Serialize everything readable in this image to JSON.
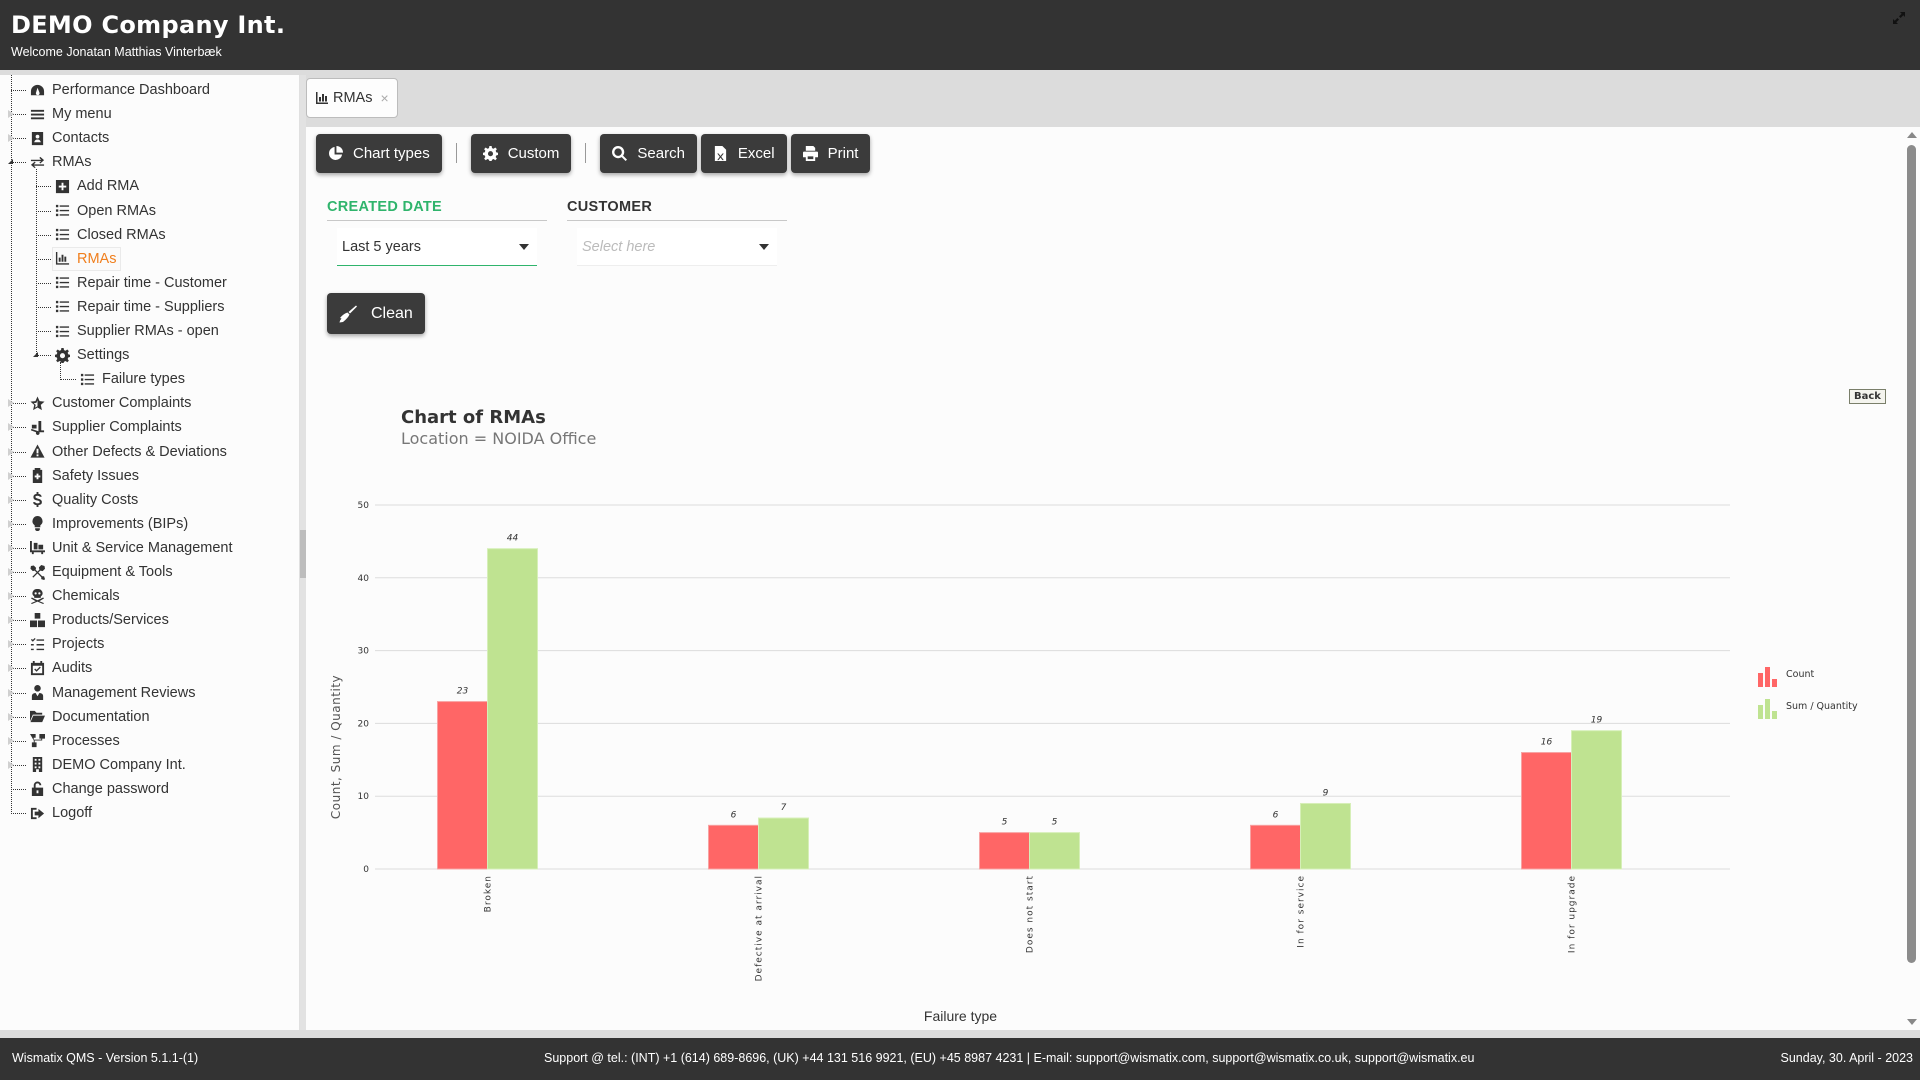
{
  "header": {
    "title": "DEMO Company Int.",
    "welcome": "Welcome Jonatan Matthias Vinterbæk",
    "expand_icon": "expand-arrows-icon"
  },
  "sidebar": {
    "items": [
      {
        "label": "Performance Dashboard",
        "icon": "dashboard-icon",
        "level": 0,
        "expander": "none"
      },
      {
        "label": "My menu",
        "icon": "bars-icon",
        "level": 0,
        "expander": "collapsed"
      },
      {
        "label": "Contacts",
        "icon": "contact-card-icon",
        "level": 0,
        "expander": "collapsed"
      },
      {
        "label": "RMAs",
        "icon": "exchange-icon",
        "level": 0,
        "expander": "expanded"
      },
      {
        "label": "Add RMA",
        "icon": "plus-square-icon",
        "level": 1,
        "expander": "none"
      },
      {
        "label": "Open RMAs",
        "icon": "list-icon",
        "level": 1,
        "expander": "none"
      },
      {
        "label": "Closed RMAs",
        "icon": "list-icon",
        "level": 1,
        "expander": "none"
      },
      {
        "label": "RMAs",
        "icon": "bar-chart-icon",
        "level": 1,
        "expander": "none",
        "active": true
      },
      {
        "label": "Repair time - Customer",
        "icon": "list-icon",
        "level": 1,
        "expander": "none"
      },
      {
        "label": "Repair time - Suppliers",
        "icon": "list-icon",
        "level": 1,
        "expander": "none"
      },
      {
        "label": "Supplier RMAs - open",
        "icon": "list-icon",
        "level": 1,
        "expander": "none"
      },
      {
        "label": "Settings",
        "icon": "gear-icon",
        "level": 1,
        "expander": "expanded"
      },
      {
        "label": "Failure types",
        "icon": "list-icon",
        "level": 2,
        "expander": "none"
      },
      {
        "label": "Customer Complaints",
        "icon": "star-outline-icon",
        "level": 0,
        "expander": "collapsed"
      },
      {
        "label": "Supplier Complaints",
        "icon": "dolly-icon",
        "level": 0,
        "expander": "collapsed"
      },
      {
        "label": "Other Defects & Deviations",
        "icon": "warning-icon",
        "level": 0,
        "expander": "collapsed"
      },
      {
        "label": "Safety Issues",
        "icon": "first-aid-icon",
        "level": 0,
        "expander": "collapsed"
      },
      {
        "label": "Quality Costs",
        "icon": "dollar-icon",
        "level": 0,
        "expander": "collapsed"
      },
      {
        "label": "Improvements (BIPs)",
        "icon": "lightbulb-icon",
        "level": 0,
        "expander": "collapsed"
      },
      {
        "label": "Unit & Service Management",
        "icon": "pallet-icon",
        "level": 0,
        "expander": "collapsed"
      },
      {
        "label": "Equipment & Tools",
        "icon": "tools-icon",
        "level": 0,
        "expander": "collapsed"
      },
      {
        "label": "Chemicals",
        "icon": "skull-crossbones-icon",
        "level": 0,
        "expander": "collapsed"
      },
      {
        "label": "Products/Services",
        "icon": "boxes-icon",
        "level": 0,
        "expander": "collapsed"
      },
      {
        "label": "Projects",
        "icon": "tasks-icon",
        "level": 0,
        "expander": "collapsed"
      },
      {
        "label": "Audits",
        "icon": "calendar-check-icon",
        "level": 0,
        "expander": "collapsed"
      },
      {
        "label": "Management Reviews",
        "icon": "user-tie-icon",
        "level": 0,
        "expander": "collapsed"
      },
      {
        "label": "Documentation",
        "icon": "folder-open-icon",
        "level": 0,
        "expander": "collapsed"
      },
      {
        "label": "Processes",
        "icon": "sitemap-icon",
        "level": 0,
        "expander": "collapsed"
      },
      {
        "label": "DEMO Company Int.",
        "icon": "building-icon",
        "level": 0,
        "expander": "collapsed"
      },
      {
        "label": "Change password",
        "icon": "unlock-icon",
        "level": 0,
        "expander": "none"
      },
      {
        "label": "Logoff",
        "icon": "sign-out-icon",
        "level": 0,
        "expander": "none"
      }
    ]
  },
  "tabs": [
    {
      "label": "RMAs",
      "icon": "bar-chart-icon",
      "close": "×"
    }
  ],
  "toolbar": {
    "chart_types": "Chart types",
    "custom": "Custom",
    "search": "Search",
    "excel": "Excel",
    "print": "Print"
  },
  "filters": {
    "created_date": {
      "label": "CREATED DATE",
      "value": "Last 5 years"
    },
    "customer": {
      "label": "CUSTOMER",
      "placeholder": "Select here"
    },
    "clean": "Clean"
  },
  "chart": {
    "back": "Back"
  },
  "colors": {
    "count": "#ff6666",
    "sum_quantity": "#bfe391",
    "active_filter": "#2fb46c",
    "active_menu": "#f07f1d",
    "header_bg": "#333333"
  },
  "chart_data": {
    "type": "bar",
    "title": "Chart of RMAs",
    "subtitle": "Location = NOIDA Office",
    "xlabel": "Failure type",
    "ylabel": "Count, Sum / Quantity",
    "ylim": [
      0,
      50
    ],
    "yticks": [
      0,
      10,
      20,
      30,
      40,
      50
    ],
    "grid": true,
    "legend_position": "right",
    "categories": [
      "Broken",
      "Defective at arrival",
      "Does not start",
      "In for service",
      "In for upgrade"
    ],
    "series": [
      {
        "name": "Count",
        "color": "#ff6666",
        "values": [
          23,
          6,
          5,
          6,
          16
        ]
      },
      {
        "name": "Sum / Quantity",
        "color": "#bfe391",
        "values": [
          44,
          7,
          5,
          9,
          19
        ]
      }
    ]
  },
  "footer": {
    "version": "Wismatix QMS - Version 5.1.1-(1)",
    "support": "Support @ tel.: (INT) +1 (614) 689-8696, (UK) +44 131 516 9921, (EU) +45 8987 4231 | E-mail: support@wismatix.com, support@wismatix.co.uk, support@wismatix.eu",
    "date": "Sunday, 30. April - 2023"
  }
}
